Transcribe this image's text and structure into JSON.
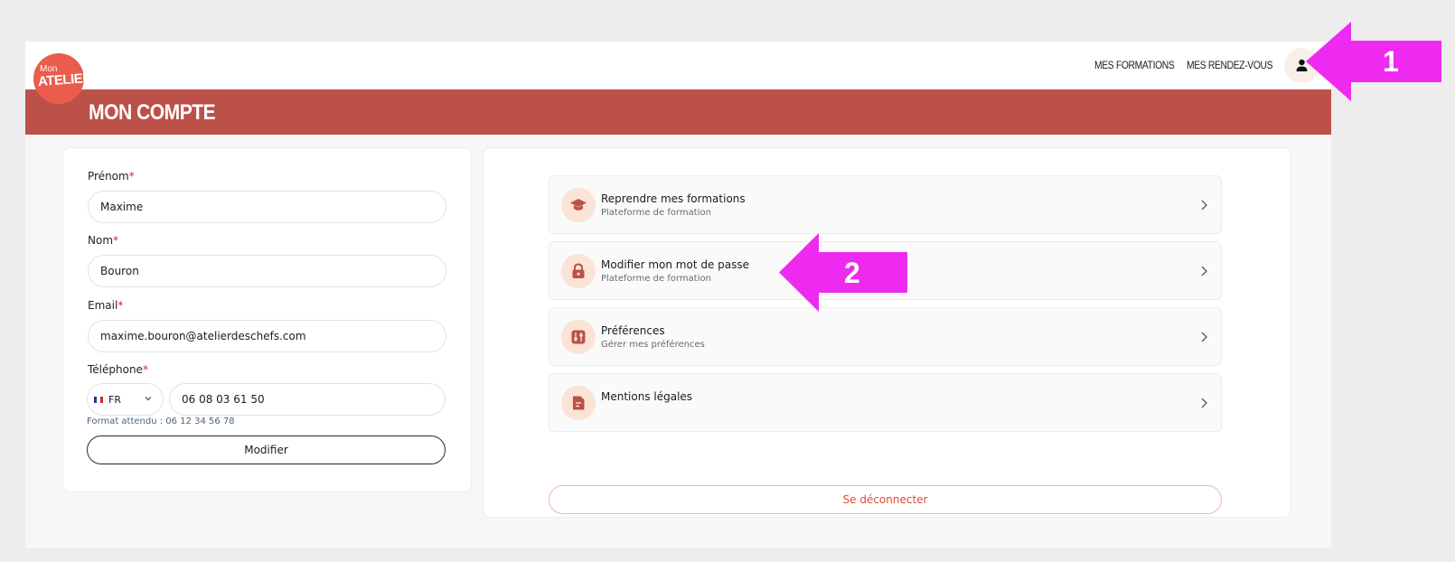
{
  "header": {
    "logo_small": "Mon",
    "logo_large": "ATELIER",
    "nav": [
      "MES FORMATIONS",
      "MES RENDEZ-VOUS"
    ],
    "avatar_icon": "user-icon"
  },
  "banner": {
    "title": "MON COMPTE"
  },
  "form": {
    "firstname_label": "Prénom",
    "firstname_value": "Maxime",
    "lastname_label": "Nom",
    "lastname_value": "Bouron",
    "email_label": "Email",
    "email_value": "maxime.bouron@atelierdeschefs.com",
    "phone_label": "Téléphone",
    "required_mark": "*",
    "country_code": "FR",
    "phone_value": "06 08 03 61 50",
    "phone_hint": "Format attendu : 06 12 34 56 78",
    "submit_label": "Modifier"
  },
  "menu": {
    "items": [
      {
        "title": "Reprendre mes formations",
        "subtitle": "Plateforme de formation",
        "icon": "graduation-cap-icon"
      },
      {
        "title": "Modifier mon mot de passe",
        "subtitle": "Plateforme de formation",
        "icon": "lock-icon"
      },
      {
        "title": "Préférences",
        "subtitle": "Gérer mes préférences",
        "icon": "sliders-icon"
      },
      {
        "title": "Mentions légales",
        "subtitle": "",
        "icon": "document-icon"
      }
    ],
    "logout_label": "Se déconnecter"
  },
  "annotations": [
    "1",
    "2"
  ],
  "colors": {
    "brand_red": "#bc514a",
    "logo_red": "#ea5c4c",
    "annotation_magenta": "#ee2af0",
    "logout_red": "#e04a36"
  }
}
